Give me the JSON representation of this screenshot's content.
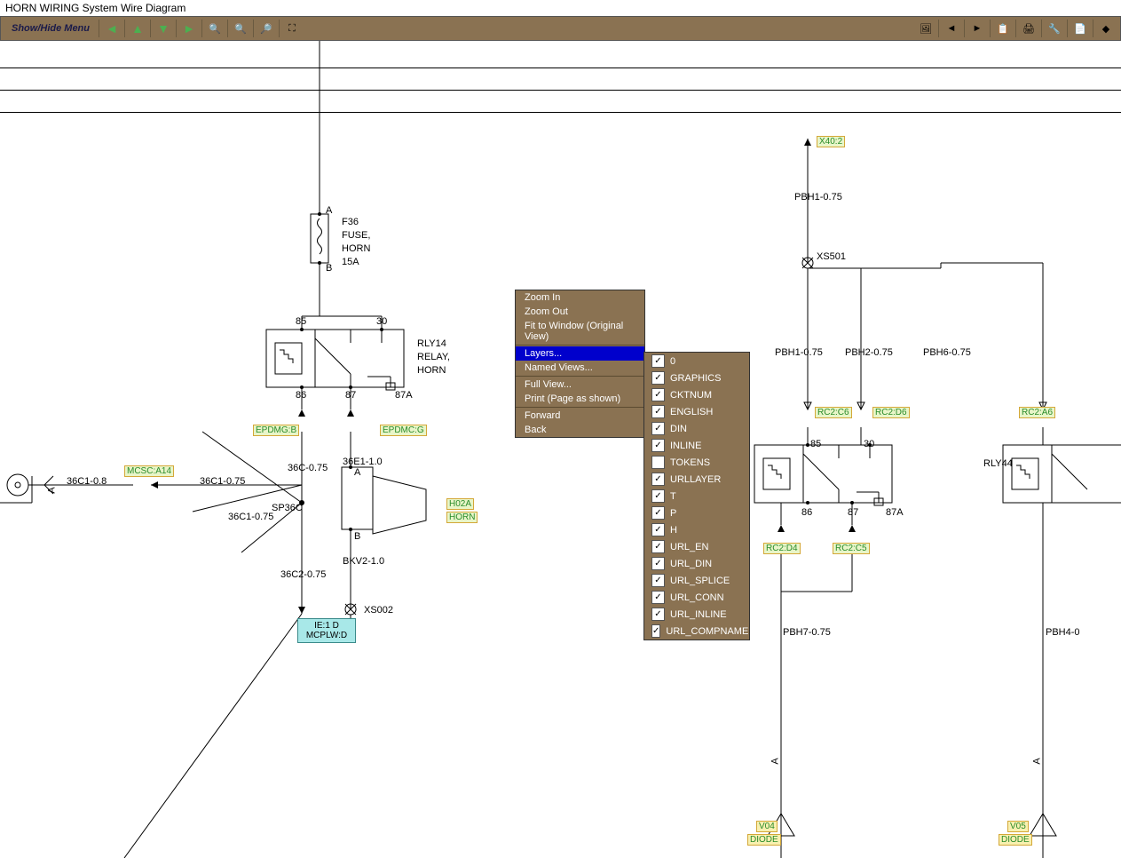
{
  "title": "HORN WIRING System Wire Diagram",
  "menu_label": "Show/Hide Menu",
  "context_menu": {
    "zoom_in": "Zoom In",
    "zoom_out": "Zoom Out",
    "fit": "Fit to Window (Original View)",
    "layers": "Layers...",
    "named_views": "Named Views...",
    "full_view": "Full View...",
    "print": "Print (Page as shown)",
    "forward": "Forward",
    "back": "Back"
  },
  "layers": [
    {
      "label": "0",
      "checked": true
    },
    {
      "label": "GRAPHICS",
      "checked": true
    },
    {
      "label": "CKTNUM",
      "checked": true
    },
    {
      "label": "ENGLISH",
      "checked": true
    },
    {
      "label": "DIN",
      "checked": true
    },
    {
      "label": "INLINE",
      "checked": true
    },
    {
      "label": "TOKENS",
      "checked": false
    },
    {
      "label": "URLLAYER",
      "checked": true
    },
    {
      "label": "T",
      "checked": true
    },
    {
      "label": "P",
      "checked": true
    },
    {
      "label": "H",
      "checked": true
    },
    {
      "label": "URL_EN",
      "checked": true
    },
    {
      "label": "URL_DIN",
      "checked": true
    },
    {
      "label": "URL_SPLICE",
      "checked": true
    },
    {
      "label": "URL_CONN",
      "checked": true
    },
    {
      "label": "URL_INLINE",
      "checked": true
    },
    {
      "label": "URL_COMPNAME",
      "checked": true
    }
  ],
  "components": {
    "fuse": {
      "id": "F36",
      "name": "FUSE,",
      "sub": "HORN",
      "rating": "15A",
      "pinA": "A",
      "pinB": "B"
    },
    "relay1": {
      "id": "RLY14",
      "name": "RELAY,",
      "sub": "HORN",
      "p85": "85",
      "p30": "30",
      "p86": "86",
      "p87": "87",
      "p87a": "87A"
    },
    "relay2": {
      "id": "RLY44",
      "p85": "85",
      "p30": "30",
      "p86": "86",
      "p87": "87",
      "p87a": "87A"
    },
    "horn": {
      "id": "H02A",
      "name": "HORN",
      "pinA": "A",
      "pinB": "B"
    },
    "conn1": "X40:2",
    "conn2": "XS501",
    "conn3": "XS002",
    "splice": "SP36C"
  },
  "wires": {
    "w1": "36C1-0.8",
    "w2": "36C1-0.75",
    "w3": "36C-0.75",
    "w4": "36C1-0.75",
    "w5": "36C2-0.75",
    "w6": "36E1-1.0",
    "w7": "BKV2-1.0",
    "w8": "PBH1-0.75",
    "w9": "PBH1-0.75",
    "w10": "PBH2-0.75",
    "w11": "PBH6-0.75",
    "w12": "PBH7-0.75",
    "w13": "PBH4-0"
  },
  "links": {
    "l1": "MCSC:A14",
    "l2": "EPDMG:B",
    "l3": "EPDMC:G",
    "l4": "RC2:C6",
    "l5": "RC2:D6",
    "l6": "RC2:A6",
    "l7": "RC2:D4",
    "l8": "RC2:C5",
    "l9": "IE:1 D",
    "l10": "MCPLW:D",
    "l11": "V04",
    "l12": "DIODE",
    "l13": "V05",
    "l14": "DIODE"
  },
  "pin_a": "A"
}
